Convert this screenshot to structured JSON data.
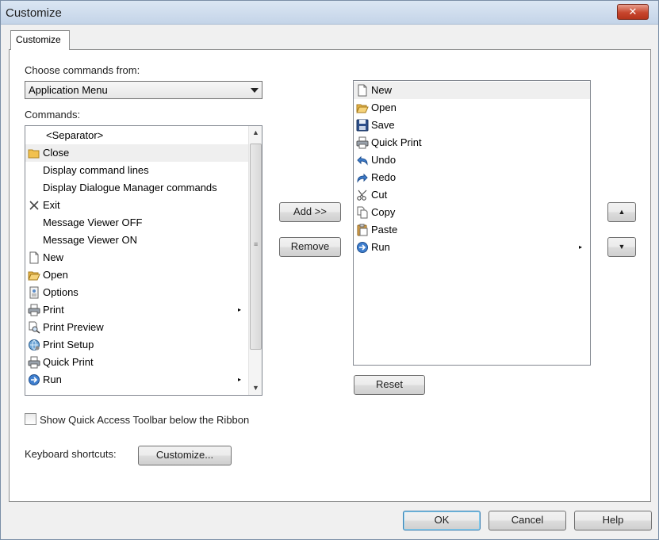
{
  "window": {
    "title": "Customize",
    "close_symbol": "✕"
  },
  "tab": {
    "label": "Customize"
  },
  "choose": {
    "label": "Choose commands from:",
    "selected": "Application Menu"
  },
  "commands": {
    "label": "Commands:",
    "items": [
      {
        "label": "<Separator>",
        "icon": "none",
        "submenu": false
      },
      {
        "label": "Close",
        "icon": "folder-icon",
        "submenu": false
      },
      {
        "label": "Display command lines",
        "icon": "none",
        "submenu": false
      },
      {
        "label": "Display Dialogue Manager commands",
        "icon": "none",
        "submenu": false
      },
      {
        "label": "Exit",
        "icon": "x-icon",
        "submenu": false
      },
      {
        "label": "Message Viewer OFF",
        "icon": "none",
        "submenu": false
      },
      {
        "label": "Message Viewer ON",
        "icon": "none",
        "submenu": false
      },
      {
        "label": "New",
        "icon": "new-document-icon",
        "submenu": false
      },
      {
        "label": "Open",
        "icon": "open-folder-icon",
        "submenu": false
      },
      {
        "label": "Options",
        "icon": "options-icon",
        "submenu": false
      },
      {
        "label": "Print",
        "icon": "printer-icon",
        "submenu": true
      },
      {
        "label": "Print Preview",
        "icon": "print-preview-icon",
        "submenu": false
      },
      {
        "label": "Print Setup",
        "icon": "print-setup-icon",
        "submenu": false
      },
      {
        "label": "Quick Print",
        "icon": "printer-icon",
        "submenu": false
      },
      {
        "label": "Run",
        "icon": "run-icon",
        "submenu": true
      }
    ],
    "selected_index": 1
  },
  "buttons": {
    "add": "Add >>",
    "remove": "Remove",
    "reset": "Reset",
    "customize": "Customize...",
    "ok": "OK",
    "cancel": "Cancel",
    "help": "Help",
    "move_up_symbol": "▲",
    "move_down_symbol": "▼"
  },
  "toolbar_items": {
    "items": [
      {
        "label": "New",
        "icon": "new-document-icon",
        "submenu": false
      },
      {
        "label": "Open",
        "icon": "open-folder-icon",
        "submenu": false
      },
      {
        "label": "Save",
        "icon": "save-icon",
        "submenu": false
      },
      {
        "label": "Quick Print",
        "icon": "printer-icon",
        "submenu": false
      },
      {
        "label": "Undo",
        "icon": "undo-icon",
        "submenu": false
      },
      {
        "label": "Redo",
        "icon": "redo-icon",
        "submenu": false
      },
      {
        "label": "Cut",
        "icon": "scissors-icon",
        "submenu": false
      },
      {
        "label": "Copy",
        "icon": "copy-icon",
        "submenu": false
      },
      {
        "label": "Paste",
        "icon": "paste-icon",
        "submenu": false
      },
      {
        "label": "Run",
        "icon": "run-icon",
        "submenu": true
      }
    ],
    "selected_index": 0
  },
  "checkbox": {
    "label": "Show Quick Access Toolbar below the Ribbon",
    "checked": false
  },
  "shortcuts": {
    "label": "Keyboard shortcuts:"
  },
  "submenu_arrow": "▸"
}
